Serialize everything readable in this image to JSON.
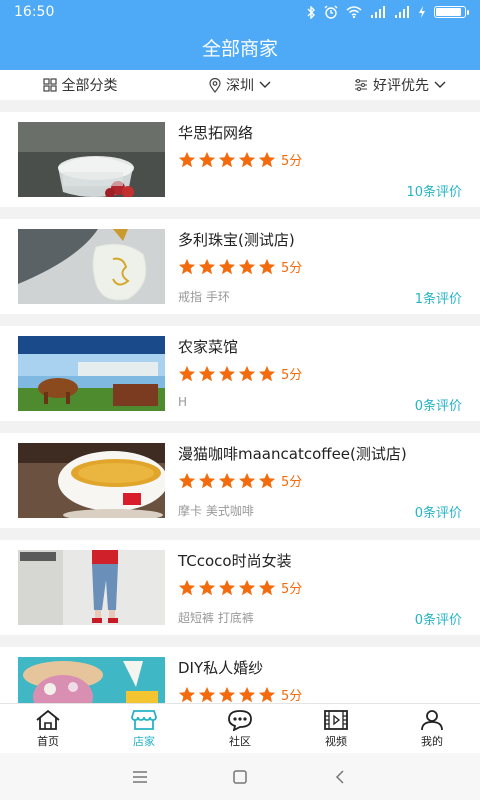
{
  "status": {
    "time": "16:50",
    "icons": [
      "bluetooth-icon",
      "alarm-icon",
      "wifi-icon",
      "signal-icon",
      "signal-icon",
      "charging-icon"
    ],
    "battery_level": 0.9
  },
  "header": {
    "title": "全部商家"
  },
  "filters": {
    "category": "全部分类",
    "city": "深圳",
    "sort": "好评优先"
  },
  "colors": {
    "primary": "#4eaaf6",
    "accent": "#26b3c6",
    "star": "#f36b0c"
  },
  "shops": [
    {
      "name": "华思拓网络",
      "rating": 5,
      "score_label": "5分",
      "tags": "",
      "reviews": "10条评价",
      "image": "glass-bowl-dessert"
    },
    {
      "name": "多利珠宝(测试店)",
      "rating": 5,
      "score_label": "5分",
      "tags": "戒指 手环",
      "reviews": "1条评价",
      "image": "jade-pendant"
    },
    {
      "name": "农家菜馆",
      "rating": 5,
      "score_label": "5分",
      "tags": "H",
      "reviews": "0条评价",
      "image": "cow-farm-banner"
    },
    {
      "name": "漫猫咖啡maancatcoffee(测试店)",
      "rating": 5,
      "score_label": "5分",
      "tags": "摩卡 美式咖啡",
      "reviews": "0条评价",
      "image": "coffee-cup"
    },
    {
      "name": "TCcoco时尚女装",
      "rating": 5,
      "score_label": "5分",
      "tags": "超短裤 打底裤",
      "reviews": "0条评价",
      "image": "fashion-jeans"
    },
    {
      "name": "DIY私人婚纱",
      "rating": 5,
      "score_label": "5分",
      "tags": "",
      "reviews": "",
      "image": "wedding-hat"
    }
  ],
  "tabs": [
    {
      "label": "首页",
      "icon": "home-icon",
      "active": false
    },
    {
      "label": "店家",
      "icon": "shop-icon",
      "active": true
    },
    {
      "label": "社区",
      "icon": "chat-icon",
      "active": false
    },
    {
      "label": "视频",
      "icon": "video-icon",
      "active": false
    },
    {
      "label": "我的",
      "icon": "user-icon",
      "active": false
    }
  ]
}
